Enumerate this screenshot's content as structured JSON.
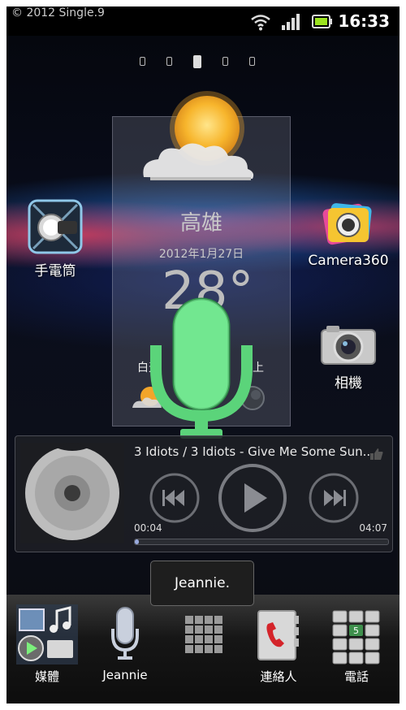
{
  "screenshot_caption": "© 2012 Single.9",
  "status_bar": {
    "time": "16:33",
    "icons": [
      "wifi-icon",
      "signal-icon",
      "battery-icon"
    ]
  },
  "home_pages": {
    "count": 5,
    "active_index": 2
  },
  "apps_left": {
    "label": "手電筒",
    "icon": "flashlight-icon"
  },
  "apps_right": [
    {
      "label": "Camera360",
      "icon": "camera360-icon"
    },
    {
      "label": "相機",
      "icon": "camera-icon"
    }
  ],
  "weather": {
    "city": "高雄",
    "date": "2012年1月27日",
    "temperature": "28°",
    "day_label": "白天",
    "night_label": "晚上",
    "condition_icon": "partly-cloudy-icon"
  },
  "voice_overlay": {
    "icon": "microphone-icon",
    "color": "#7cff9a"
  },
  "music_player": {
    "track": "3 Idiots / 3 Idiots - Give Me Some Sun...",
    "elapsed": "00:04",
    "duration": "04:07",
    "progress": 0.016
  },
  "toast": {
    "text": "Jeannie."
  },
  "dock": [
    {
      "label": "媒體",
      "icon": "media-icon"
    },
    {
      "label": "Jeannie",
      "icon": "microphone-icon"
    },
    {
      "label": "",
      "icon": "app-drawer-icon"
    },
    {
      "label": "連絡人",
      "icon": "contacts-icon"
    },
    {
      "label": "電話",
      "icon": "dialer-icon"
    }
  ]
}
